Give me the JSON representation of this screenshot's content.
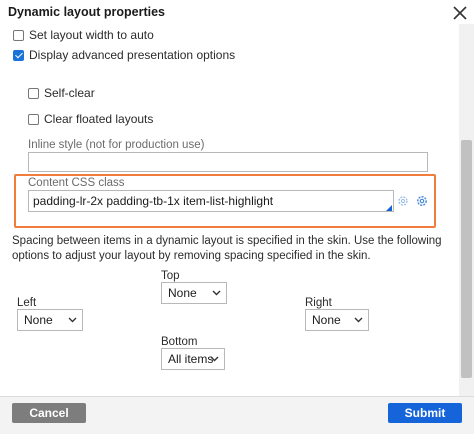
{
  "dialog": {
    "title": "Dynamic layout properties",
    "close_icon": "close-icon"
  },
  "options": {
    "set_width_auto": {
      "label": "Set layout width to auto",
      "checked": false
    },
    "display_advanced": {
      "label": "Display advanced presentation options",
      "checked": true
    },
    "self_clear": {
      "label": "Self-clear",
      "checked": false
    },
    "clear_floated": {
      "label": "Clear floated layouts",
      "checked": false
    }
  },
  "inline_style": {
    "label": "Inline style (not for production use)",
    "value": ""
  },
  "content_css": {
    "label": "Content CSS class",
    "value": "padding-lr-2x padding-tb-1x item-list-highlight",
    "icons": [
      "gear-icon",
      "gear-icon"
    ],
    "highlight_color": "#f07d3c"
  },
  "spacing": {
    "info": "Spacing between items in a dynamic layout is specified in the skin. Use the following options to adjust your layout by removing spacing specified in the skin.",
    "top": {
      "label": "Top",
      "value": "None"
    },
    "left": {
      "label": "Left",
      "value": "None"
    },
    "right": {
      "label": "Right",
      "value": "None"
    },
    "bottom": {
      "label": "Bottom",
      "value": "All items"
    }
  },
  "footer": {
    "cancel_label": "Cancel",
    "submit_label": "Submit",
    "submit_color": "#1664d9"
  }
}
